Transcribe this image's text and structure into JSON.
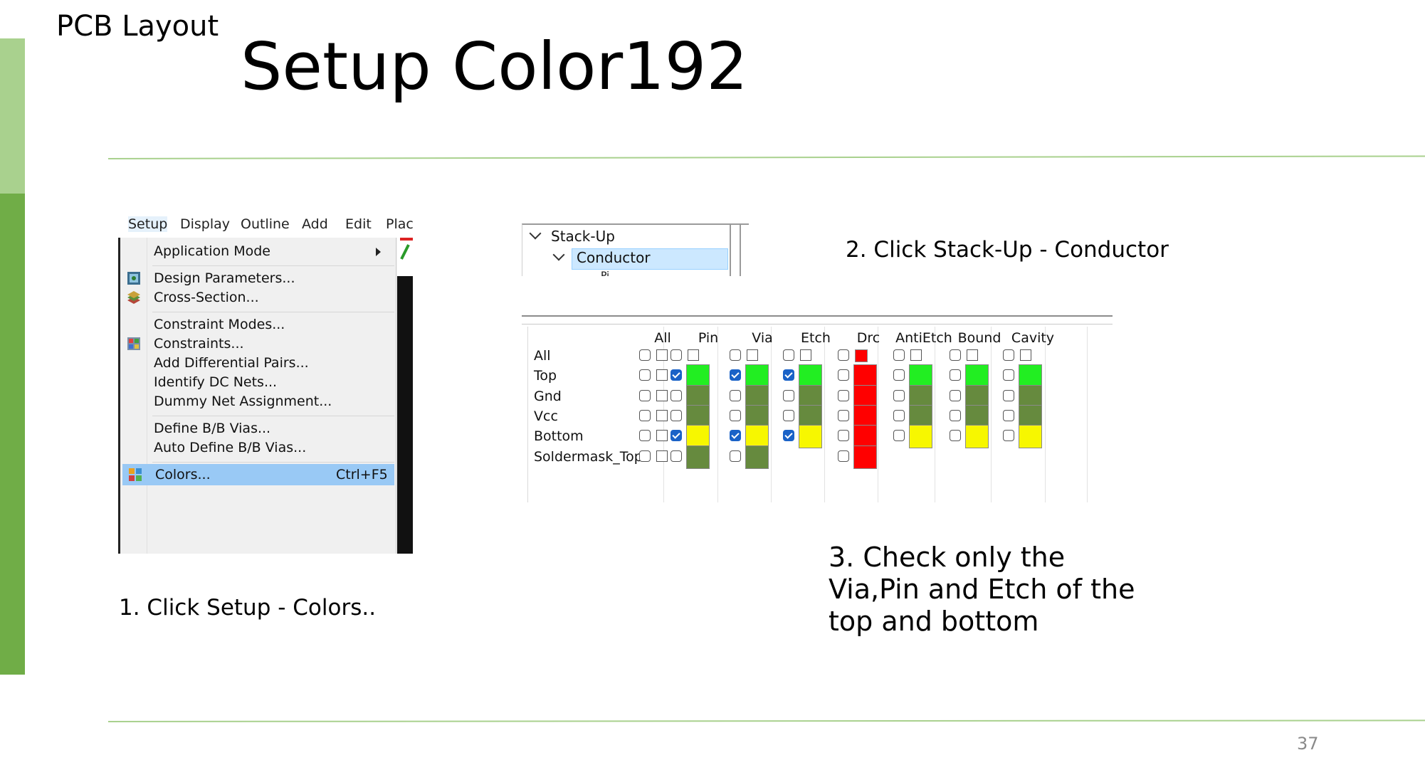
{
  "slide": {
    "section_label": "PCB Layout",
    "title": "Setup Color192",
    "page_number": "37",
    "captions": {
      "step1": "1. Click Setup - Colors..",
      "step2": "2. Click Stack-Up - Conductor",
      "step3_lines": [
        "3. Check only the",
        "Via,Pin and Etch of the",
        "top and bottom"
      ]
    }
  },
  "menu": {
    "menubar": [
      "Setup",
      "Display",
      "Outline",
      "Add",
      "Edit",
      "Plac"
    ],
    "items": [
      {
        "label": "Application Mode",
        "submenu": true
      },
      {
        "label": "Design Parameters...",
        "icon": "design-parameters-icon"
      },
      {
        "label": "Cross-Section...",
        "icon": "cross-section-icon"
      },
      {
        "label": "Constraint Modes..."
      },
      {
        "label": "Constraints...",
        "icon": "constraints-icon"
      },
      {
        "label": "Add Differential Pairs..."
      },
      {
        "label": "Identify DC Nets..."
      },
      {
        "label": "Dummy Net Assignment..."
      },
      {
        "label": "Define B/B Vias..."
      },
      {
        "label": "Auto Define B/B Vias..."
      },
      {
        "label": "Colors...",
        "shortcut": "Ctrl+F5",
        "icon": "colors-icon",
        "highlighted": true
      }
    ]
  },
  "tree": {
    "root": "Stack-Up",
    "child": "Conductor",
    "grandchild_partial": "Pi"
  },
  "color_grid": {
    "columns": [
      "All",
      "Pin",
      "Via",
      "Etch",
      "Drc",
      "AntiEtch",
      "Bound",
      "Cavity"
    ],
    "rows": [
      {
        "name": "All",
        "cells": {
          "All": null,
          "Pin": null,
          "Via": null,
          "Etch": null,
          "Drc": {
            "checked": false,
            "color": "red"
          },
          "AntiEtch": null,
          "Bound": null,
          "Cavity": null
        }
      },
      {
        "name": "Top",
        "cells": {
          "Pin": {
            "checked": true,
            "color": "bright-green"
          },
          "Via": {
            "checked": true,
            "color": "bright-green"
          },
          "Etch": {
            "checked": true,
            "color": "bright-green"
          },
          "Drc": {
            "checked": false,
            "color": "red"
          },
          "AntiEtch": {
            "checked": false,
            "color": "bright-green"
          },
          "Bound": {
            "checked": false,
            "color": "bright-green"
          },
          "Cavity": {
            "checked": false,
            "color": "bright-green"
          }
        }
      },
      {
        "name": "Gnd",
        "cells": {
          "Pin": {
            "checked": false,
            "color": "olive-green"
          },
          "Via": {
            "checked": false,
            "color": "olive-green"
          },
          "Etch": {
            "checked": false,
            "color": "olive-green"
          },
          "Drc": {
            "checked": false,
            "color": "red"
          },
          "AntiEtch": {
            "checked": false,
            "color": "olive-green"
          },
          "Bound": {
            "checked": false,
            "color": "olive-green"
          },
          "Cavity": {
            "checked": false,
            "color": "olive-green"
          }
        }
      },
      {
        "name": "Vcc",
        "cells": {
          "Pin": {
            "checked": false,
            "color": "olive-green"
          },
          "Via": {
            "checked": false,
            "color": "olive-green"
          },
          "Etch": {
            "checked": false,
            "color": "olive-green"
          },
          "Drc": {
            "checked": false,
            "color": "red"
          },
          "AntiEtch": {
            "checked": false,
            "color": "olive-green"
          },
          "Bound": {
            "checked": false,
            "color": "olive-green"
          },
          "Cavity": {
            "checked": false,
            "color": "olive-green"
          }
        }
      },
      {
        "name": "Bottom",
        "cells": {
          "Pin": {
            "checked": true,
            "color": "yellow"
          },
          "Via": {
            "checked": true,
            "color": "yellow"
          },
          "Etch": {
            "checked": true,
            "color": "yellow"
          },
          "Drc": {
            "checked": false,
            "color": "red"
          },
          "AntiEtch": {
            "checked": false,
            "color": "yellow"
          },
          "Bound": {
            "checked": false,
            "color": "yellow"
          },
          "Cavity": {
            "checked": false,
            "color": "yellow"
          }
        }
      },
      {
        "name": "Soldermask_Top",
        "cells": {
          "Pin": {
            "checked": false,
            "color": "olive-green"
          },
          "Via": {
            "checked": false,
            "color": "olive-green"
          },
          "Drc": {
            "checked": false,
            "color": "red"
          }
        }
      }
    ]
  },
  "palette": {
    "accent_light": "#a9d18e",
    "accent_dark": "#70ad47",
    "bright-green": "#22ee22",
    "olive-green": "#668a3e",
    "yellow": "#f7f700",
    "red": "#ff0000",
    "menu_highlight": "#99c9f5",
    "checkbox_checked": "#1a62c7"
  }
}
